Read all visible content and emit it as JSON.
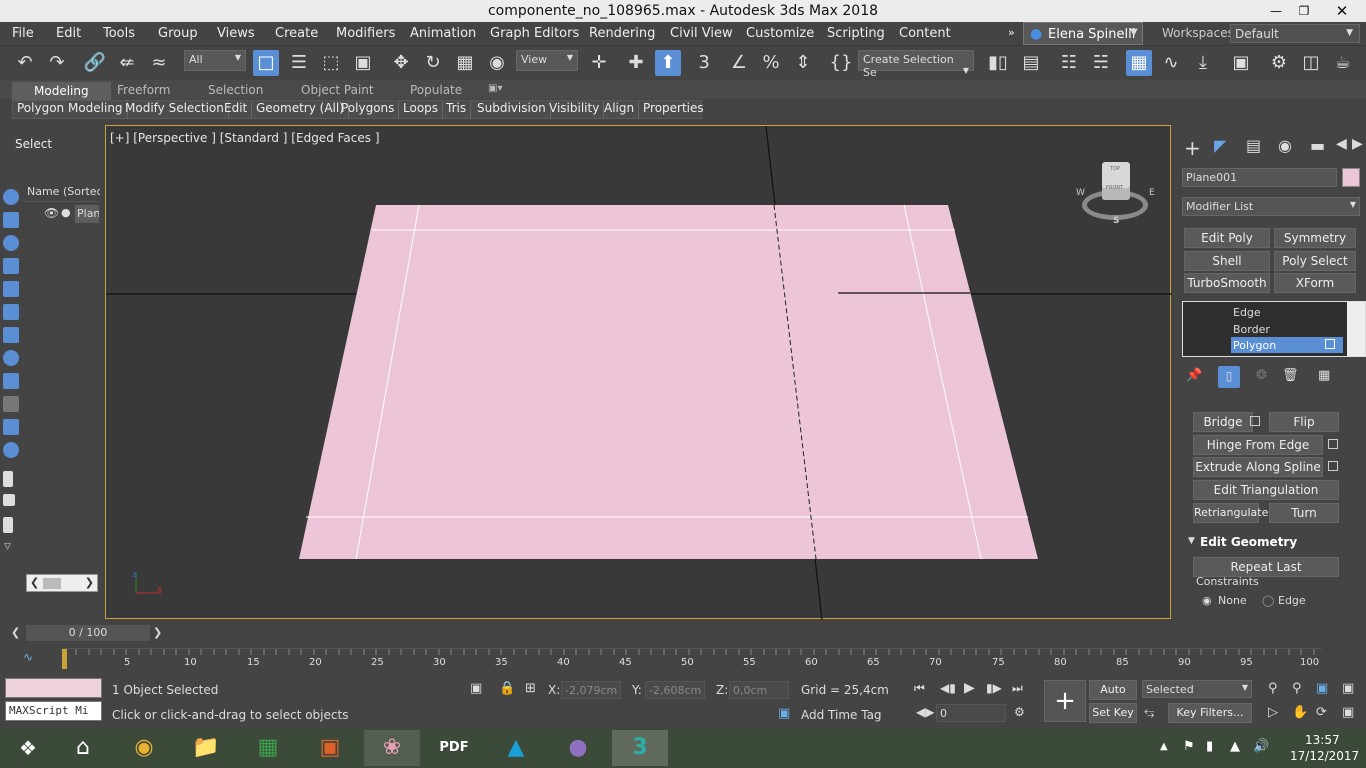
{
  "window": {
    "title": "componente_no_108965.max - Autodesk 3ds Max 2018"
  },
  "menu": [
    "File",
    "Edit",
    "Tools",
    "Group",
    "Views",
    "Create",
    "Modifiers",
    "Animation",
    "Graph Editors",
    "Rendering",
    "Civil View",
    "Customize",
    "Scripting",
    "Content"
  ],
  "user": {
    "name": "Elena Spinelli",
    "workspaces_label": "Workspaces:",
    "workspace": "Default"
  },
  "toolbar": {
    "filter": "All",
    "coord": "View",
    "selection_set": "Create Selection Se"
  },
  "ribbon": {
    "tabs": [
      "Modeling",
      "Freeform",
      "Selection",
      "Object Paint",
      "Populate"
    ],
    "subtabs": [
      "Polygon Modeling",
      "Modify Selection",
      "Edit",
      "Geometry (All)",
      "Polygons",
      "Loops",
      "Tris",
      "Subdivision",
      "Visibility",
      "Align",
      "Properties"
    ]
  },
  "scene_explorer": {
    "header": "Select",
    "column": "Name (Sorted A",
    "item": "Plan"
  },
  "viewport": {
    "label": "[+] [Perspective ] [Standard ] [Edged Faces ]",
    "cube": {
      "top": "TOP",
      "front": "FRONT",
      "w": "W",
      "e": "E",
      "s": "S"
    }
  },
  "command_panel": {
    "object_name": "Plane001",
    "modifier_list": "Modifier List",
    "mod_buttons": [
      "Edit Poly",
      "Symmetry",
      "Shell",
      "Poly Select",
      "TurboSmooth",
      "XForm"
    ],
    "stack": [
      "Edge",
      "Border",
      "Polygon"
    ],
    "edit_buttons": {
      "bridge": "Bridge",
      "flip": "Flip",
      "hinge": "Hinge From Edge",
      "extrude": "Extrude Along Spline",
      "edit_tri": "Edit Triangulation",
      "retri": "Retriangulate",
      "turn": "Turn"
    },
    "edit_geometry": {
      "title": "Edit Geometry",
      "repeat": "Repeat Last",
      "constraints": "Constraints",
      "none": "None",
      "edge": "Edge"
    }
  },
  "timeline": {
    "frame": "0 / 100",
    "ticks": [
      "5",
      "10",
      "15",
      "20",
      "25",
      "30",
      "35",
      "40",
      "45",
      "50",
      "55",
      "60",
      "65",
      "70",
      "75",
      "80",
      "85",
      "90",
      "95",
      "100"
    ]
  },
  "status": {
    "selected": "1 Object Selected",
    "prompt": "Click or click-and-drag to select objects",
    "maxscript": "MAXScript Mi",
    "x_label": "X:",
    "x": "-2,079cm",
    "y_label": "Y:",
    "y": "-2,608cm",
    "z_label": "Z:",
    "z": "0,0cm",
    "grid": "Grid = 25,4cm",
    "add_time_tag": "Add Time Tag",
    "auto_key": "Auto Key",
    "set_key": "Set Key",
    "key_mode": "Selected",
    "key_filters": "Key Filters...",
    "frame": "0"
  },
  "taskbar": {
    "time": "13:57",
    "date": "17/12/2017"
  },
  "colors": {
    "plane": "#ecc6d8",
    "accent": "#5a8fd6"
  }
}
